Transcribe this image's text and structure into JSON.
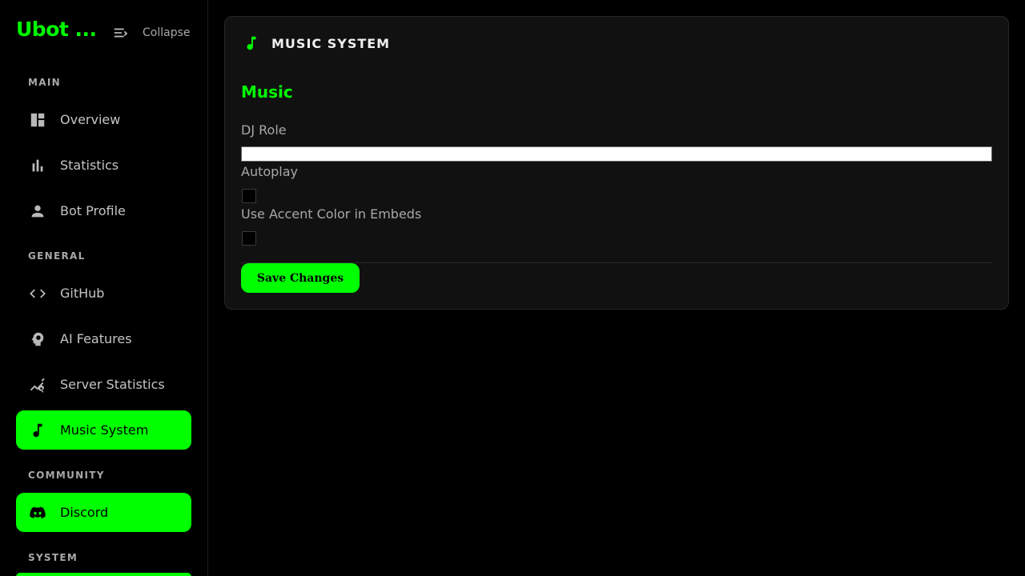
{
  "brand": {
    "name": "Ubot ..."
  },
  "collapse": {
    "label": "Collapse",
    "icon": "collapse-icon"
  },
  "sidebar": {
    "sections": [
      {
        "label": "MAIN"
      },
      {
        "label": "GENERAL"
      },
      {
        "label": "COMMUNITY"
      },
      {
        "label": "SYSTEM"
      }
    ],
    "items": [
      {
        "label": "Overview",
        "icon": "dashboard-icon",
        "active": false
      },
      {
        "label": "Statistics",
        "icon": "bar-chart-icon",
        "active": false
      },
      {
        "label": "Bot Profile",
        "icon": "person-icon",
        "active": false
      },
      {
        "label": "GitHub",
        "icon": "code-icon",
        "active": false
      },
      {
        "label": "AI Features",
        "icon": "brain-icon",
        "active": false
      },
      {
        "label": "Server Statistics",
        "icon": "query-stats-icon",
        "active": false
      },
      {
        "label": "Music System",
        "icon": "music-note-icon",
        "active": true
      },
      {
        "label": "Discord",
        "icon": "discord-icon",
        "active": true
      }
    ]
  },
  "card": {
    "title": "MUSIC SYSTEM",
    "icon": "music-note-icon",
    "section_heading": "Music",
    "fields": {
      "dj_role_label": "DJ Role",
      "dj_role_value": "",
      "autoplay_label": "Autoplay",
      "autoplay_checked": false,
      "accent_label": "Use Accent Color in Embeds",
      "accent_checked": false
    },
    "save_label": "Save Changes"
  },
  "colors": {
    "accent": "#00ff00",
    "background": "#000000",
    "card": "#111111",
    "muted_text": "#a8a8a8"
  }
}
